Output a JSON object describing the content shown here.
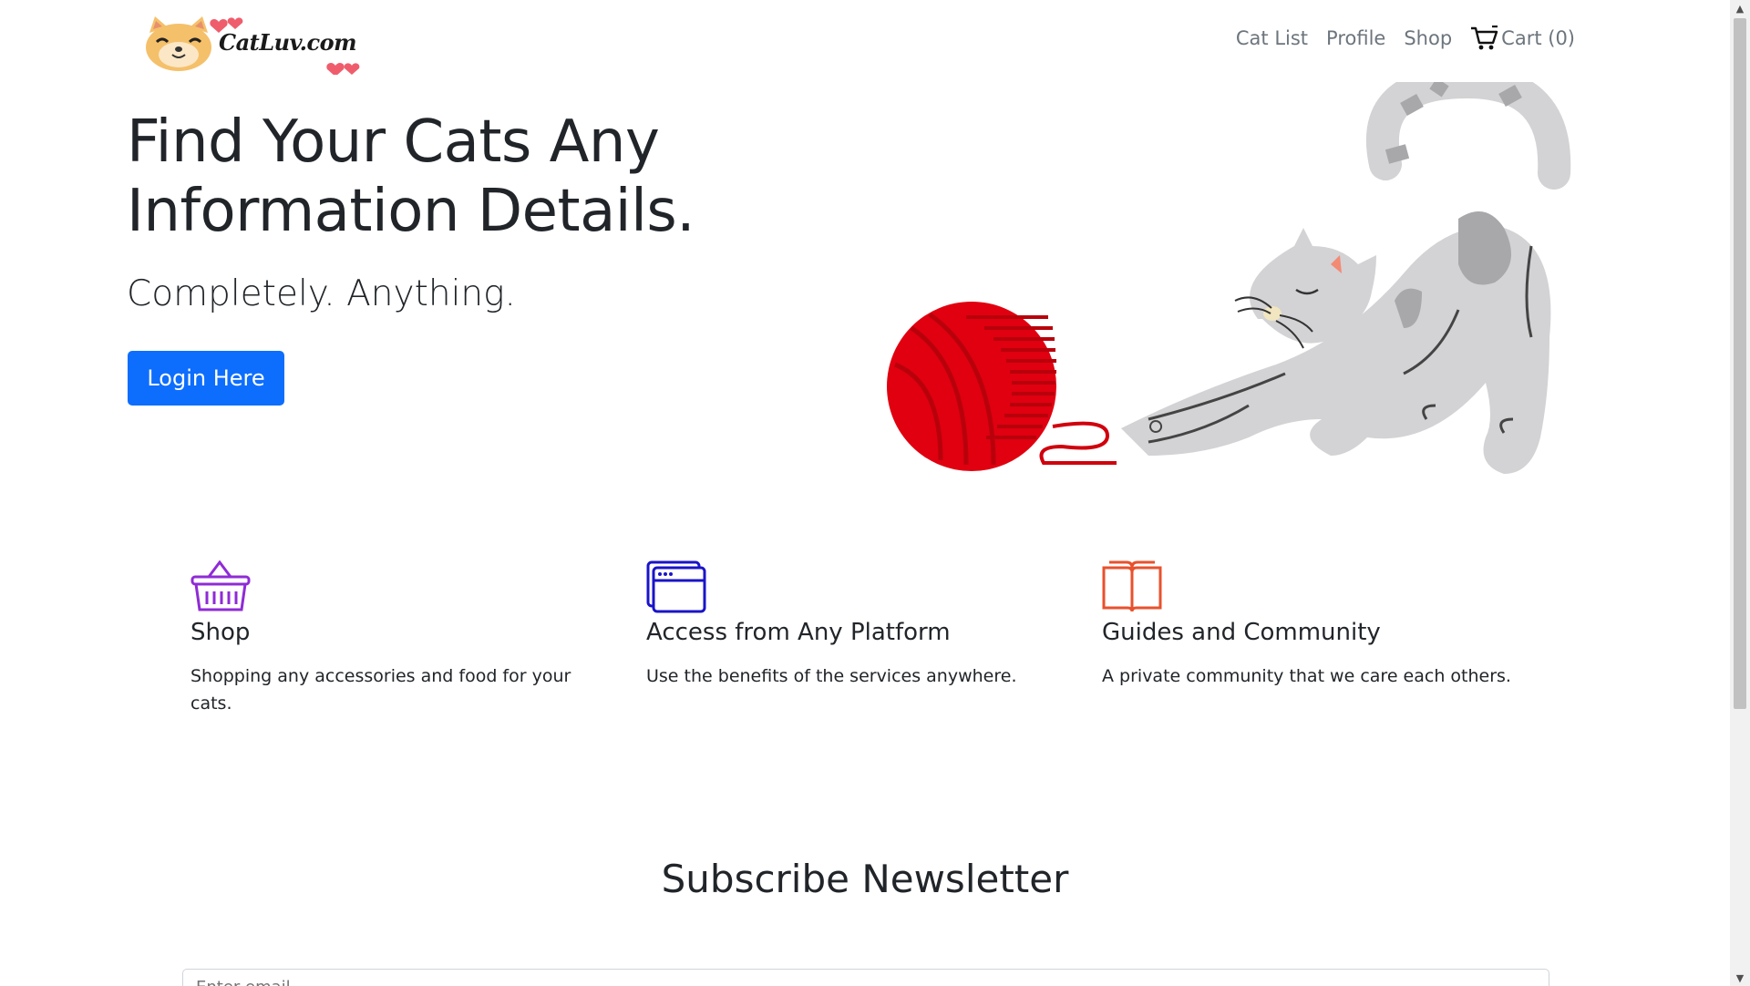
{
  "brand": {
    "name": "CatLuv.com"
  },
  "nav": {
    "items": [
      {
        "label": "Cat List"
      },
      {
        "label": "Profile"
      },
      {
        "label": "Shop"
      }
    ],
    "cart_label": "Cart (0)"
  },
  "hero": {
    "title_line1": "Find Your Cats Any",
    "title_line2": "Information Details.",
    "subtitle": "Completely. Anything.",
    "login_label": "Login Here"
  },
  "features": [
    {
      "icon": "basket-icon",
      "icon_color": "#8f2bd6",
      "title": "Shop",
      "text": "Shopping any accessories and food for your cats."
    },
    {
      "icon": "browser-window-icon",
      "icon_color": "#1a14c9",
      "title": "Access from Any Platform",
      "text": "Use the benefits of the services anywhere."
    },
    {
      "icon": "open-book-icon",
      "icon_color": "#e8512d",
      "title": "Guides and Community",
      "text": "A private community that we care each others."
    }
  ],
  "newsletter": {
    "title": "Subscribe Newsletter",
    "placeholder": "Enter email"
  },
  "colors": {
    "primary": "#0d6efd",
    "nav_text": "#6c757d",
    "yarn_red": "#e00010",
    "cat_gray": "#d3d2d4"
  }
}
